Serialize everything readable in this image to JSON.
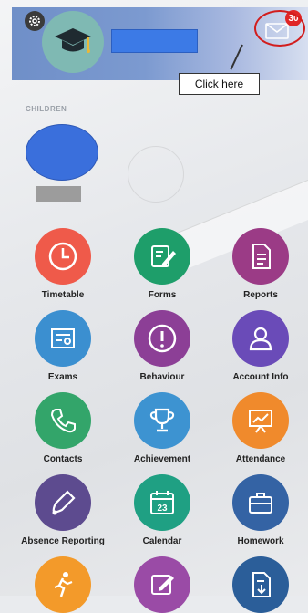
{
  "header": {
    "settings_icon": "gear-icon",
    "avatar_icon": "graduation-cap-icon",
    "messages_icon": "envelope-icon",
    "messages_count": "30"
  },
  "callout": {
    "text": "Click here"
  },
  "children": {
    "label": "CHILDREN"
  },
  "tiles": [
    {
      "label": "Timetable",
      "icon": "clock-icon",
      "color": "#ef5a4a"
    },
    {
      "label": "Forms",
      "icon": "form-edit-icon",
      "color": "#1e9e6a"
    },
    {
      "label": "Reports",
      "icon": "report-document-icon",
      "color": "#9b3b86"
    },
    {
      "label": "Exams",
      "icon": "certificate-icon",
      "color": "#3b8fd0"
    },
    {
      "label": "Behaviour",
      "icon": "exclamation-icon",
      "color": "#8c3f96"
    },
    {
      "label": "Account Info",
      "icon": "user-icon",
      "color": "#6a4bb8"
    },
    {
      "label": "Contacts",
      "icon": "phone-icon",
      "color": "#33a56a"
    },
    {
      "label": "Achievement",
      "icon": "trophy-icon",
      "color": "#3d93d1"
    },
    {
      "label": "Attendance",
      "icon": "presentation-board-icon",
      "color": "#f08a2c"
    },
    {
      "label": "Absence Reporting",
      "icon": "bell-icon",
      "color": "#5d4b8f"
    },
    {
      "label": "Calendar",
      "icon": "calendar-icon",
      "color": "#1fa083"
    },
    {
      "label": "Homework",
      "icon": "briefcase-icon",
      "color": "#3463a4"
    },
    {
      "label": "",
      "icon": "running-icon",
      "color": "#f39a2a"
    },
    {
      "label": "",
      "icon": "edit-note-icon",
      "color": "#9a4ba6"
    },
    {
      "label": "",
      "icon": "download-document-icon",
      "color": "#2b5e99"
    }
  ],
  "calendar_day": "23"
}
